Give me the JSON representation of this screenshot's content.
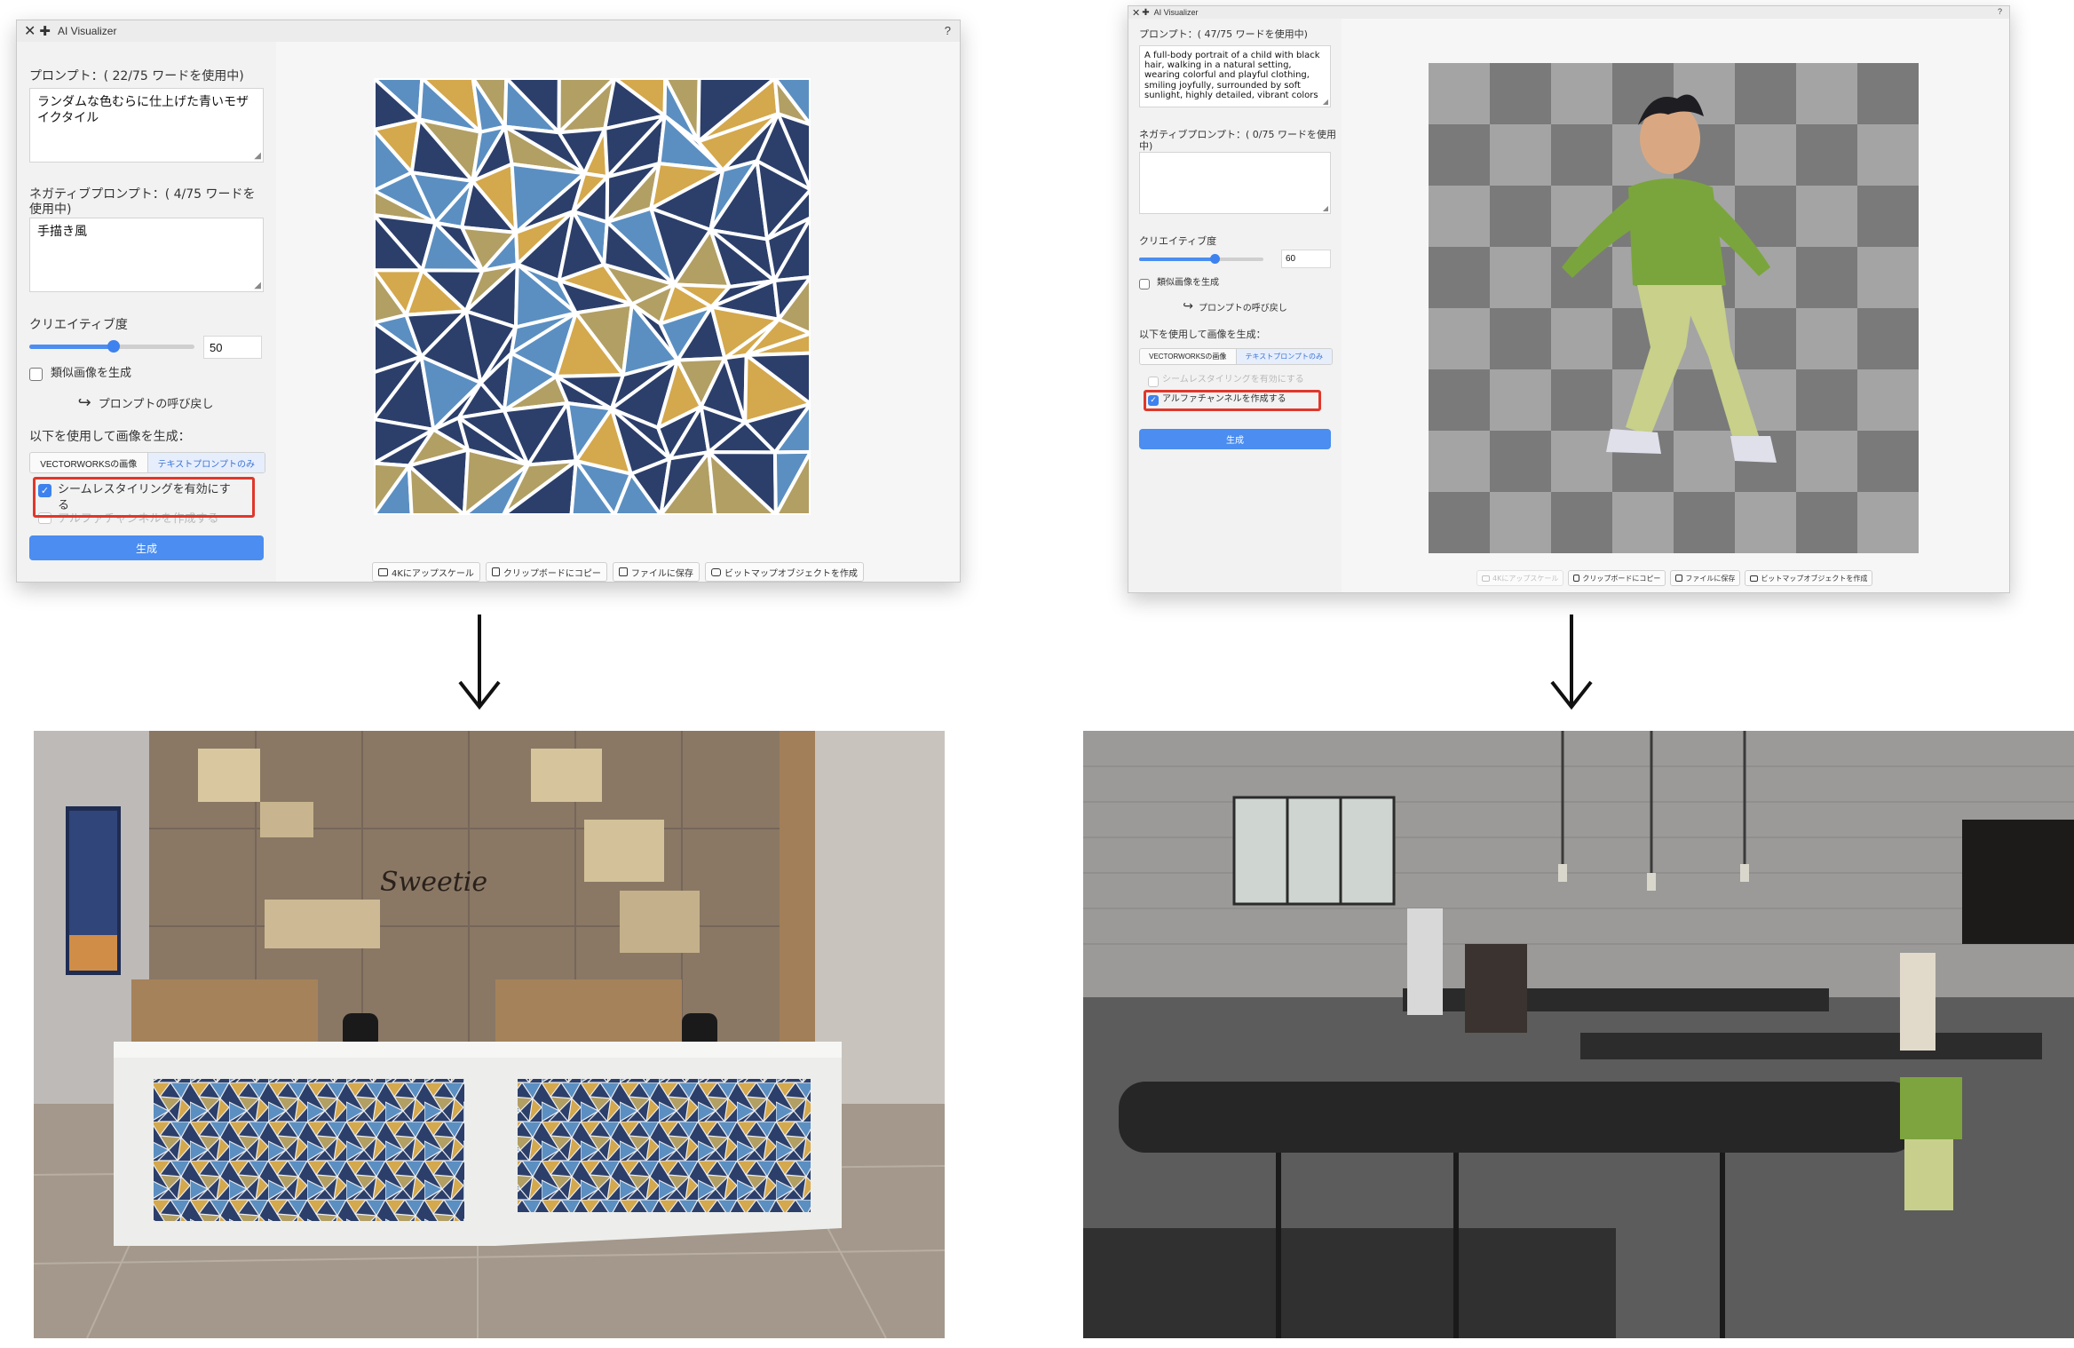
{
  "left_window": {
    "title": "AI Visualizer",
    "help": "?",
    "prompt_label": "プロンプト：( 22/75 ワードを使用中)",
    "prompt_value": "ランダムな色むらに仕上げた青いモザイクタイル",
    "neg_label": "ネガティブプロンプト：( 4/75 ワードを使用中)",
    "neg_value": "手描き風",
    "creativity_label": "クリエイティブ度",
    "creativity_value": "50",
    "creativity_level": 0.5,
    "similar_label": "類似画像を生成",
    "recall_label": "プロンプトの呼び戻し",
    "generate_using_label": "以下を使用して画像を生成：",
    "seg_vectorworks": "VECTORWORKSの画像",
    "seg_text": "テキストプロンプトのみ",
    "seamless_label": "シームレスタイリングを有効にする",
    "alpha_label": "アルファチャンネルを作成する",
    "generate_button": "生成",
    "toolbar": [
      "4Kにアップスケール",
      "クリップボードにコピー",
      "ファイルに保存",
      "ビットマップオブジェクトを作成"
    ]
  },
  "right_window": {
    "title": "AI Visualizer",
    "help": "?",
    "prompt_label": "プロンプト：( 47/75 ワードを使用中)",
    "prompt_value": "A full-body portrait of a child with black hair, walking in a natural setting, wearing colorful and playful clothing, smiling joyfully, surrounded by soft sunlight, highly detailed, vibrant colors",
    "neg_label": "ネガティブプロンプト：( 0/75 ワードを使用中)",
    "neg_value": "",
    "creativity_label": "クリエイティブ度",
    "creativity_value": "60",
    "creativity_level": 0.6,
    "similar_label": "類似画像を生成",
    "recall_label": "プロンプトの呼び戻し",
    "generate_using_label": "以下を使用して画像を生成：",
    "seg_vectorworks": "VECTORWORKSの画像",
    "seg_text": "テキストプロンプトのみ",
    "seamless_label": "シームレスタイリングを有効にする",
    "alpha_label": "アルファチャンネルを作成する",
    "generate_button": "生成",
    "toolbar": [
      "4Kにアップスケール",
      "クリップボードにコピー",
      "ファイルに保存",
      "ビットマップオブジェクトを作成"
    ]
  },
  "colors": {
    "accent": "#3d82ee",
    "highlight": "#e0372b",
    "tile_navy": "#2c3f6b",
    "tile_blue": "#5b8fc2",
    "tile_gold": "#d4a84c",
    "tile_khaki": "#b29f64",
    "checker_dark": "#7a7a7a",
    "checker_light": "#a4a4a4"
  },
  "scene_signage": "Sweetie"
}
